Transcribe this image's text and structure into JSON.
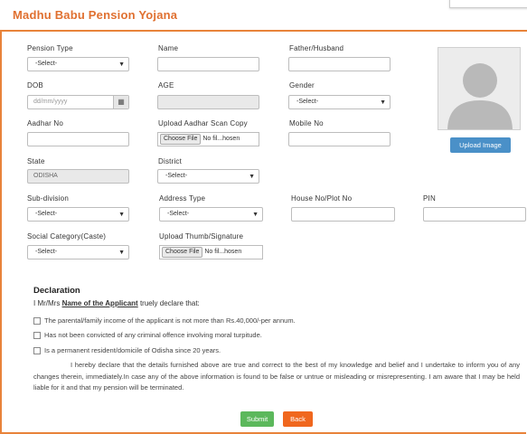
{
  "header": {
    "title": "Madhu Babu Pension Yojana"
  },
  "fields": {
    "pension_type": {
      "label": "Pension Type",
      "value": "-Select-"
    },
    "name": {
      "label": "Name",
      "value": ""
    },
    "father_husband": {
      "label": "Father/Husband",
      "value": ""
    },
    "dob": {
      "label": "DOB",
      "placeholder": "dd/mm/yyyy"
    },
    "age": {
      "label": "AGE",
      "value": ""
    },
    "gender": {
      "label": "Gender",
      "value": "-Select-"
    },
    "aadhar_no": {
      "label": "Aadhar No",
      "value": ""
    },
    "aadhar_scan": {
      "label": "Upload Aadhar Scan Copy",
      "button": "Choose File",
      "status": "No fil...hosen"
    },
    "mobile_no": {
      "label": "Mobile No",
      "value": ""
    },
    "state": {
      "label": "State",
      "value": "ODISHA"
    },
    "district": {
      "label": "District",
      "value": "-Select-"
    },
    "sub_division": {
      "label": "Sub-division",
      "value": "-Select-"
    },
    "address_type": {
      "label": "Address Type",
      "value": "-Select-"
    },
    "house_no": {
      "label": "House No/Plot No",
      "value": ""
    },
    "pin": {
      "label": "PIN",
      "value": ""
    },
    "social_category": {
      "label": "Social Category(Caste)",
      "value": "-Select-"
    },
    "thumb_signature": {
      "label": "Upload Thumb/Signature",
      "button": "Choose File",
      "status": "No fil...hosen"
    }
  },
  "photo": {
    "icon": "user-avatar-icon",
    "upload_label": "Upload Image"
  },
  "declaration": {
    "title": "Declaration",
    "intro_prefix": "I Mr/Mrs",
    "intro_name": "Name of the Applicant",
    "intro_suffix": "truely declare that:",
    "items": [
      "The parental/family income of the applicant is not more than Rs.40,000/-per annum.",
      "Has not been convicted of any criminal offence involving moral turpitude.",
      "Is a permanent resident/domicile of Odisha since 20 years."
    ],
    "statement": "I hereby declare that the details furnished above are true and correct to the best of my knowledge and belief and I undertake to inform you of any changes therein, immediately.In case any of the above information is found to be false or untrue or misleading or misrepresenting. I am aware that I may be held liable for it and that my pension will be terminated."
  },
  "actions": {
    "submit": "Submit",
    "back": "Back"
  },
  "colors": {
    "accent": "#e8833a",
    "title": "#e07030",
    "upload": "#4a90c8",
    "submit": "#5cb85c",
    "back": "#f0671e"
  }
}
